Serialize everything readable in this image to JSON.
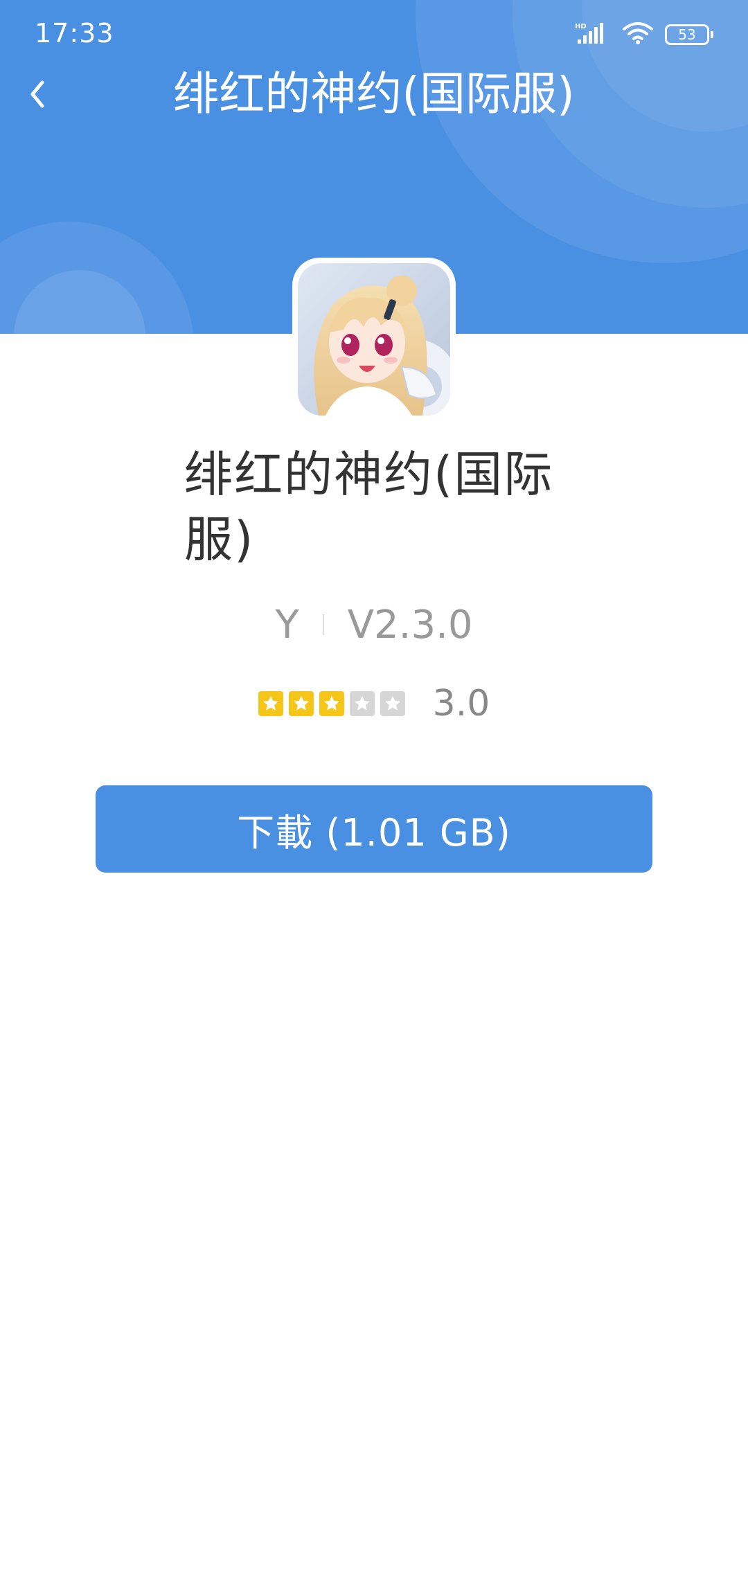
{
  "status_bar": {
    "time": "17:33",
    "battery": "53"
  },
  "nav": {
    "title": "绯红的神约(国际服)"
  },
  "app": {
    "name": "绯红的神约(国际服)",
    "developer": "Y",
    "version": "V2.3.0",
    "rating": 3.0,
    "rating_label": "3.0",
    "max_stars": 5
  },
  "actions": {
    "download_label": "下載 (1.01 GB)"
  },
  "colors": {
    "primary": "#4a90e2",
    "star_filled": "#f5c518",
    "star_empty": "#d6d6d6",
    "text_muted": "#999999"
  }
}
